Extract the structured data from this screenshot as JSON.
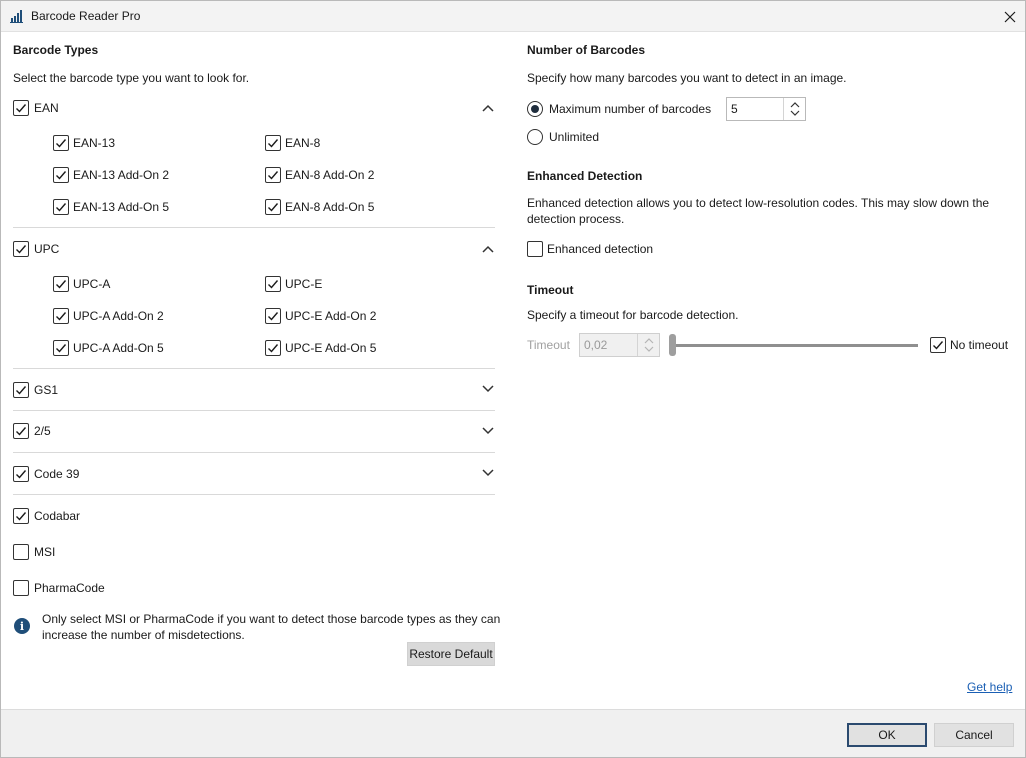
{
  "window": {
    "title": "Barcode Reader Pro"
  },
  "barcode_types": {
    "heading": "Barcode Types",
    "description": "Select the barcode type you want to look for.",
    "ean": {
      "label": "EAN",
      "checked": true,
      "expanded": true,
      "items": [
        {
          "label": "EAN-13",
          "checked": true
        },
        {
          "label": "EAN-8",
          "checked": true
        },
        {
          "label": "EAN-13 Add-On 2",
          "checked": true
        },
        {
          "label": "EAN-8 Add-On 2",
          "checked": true
        },
        {
          "label": "EAN-13 Add-On 5",
          "checked": true
        },
        {
          "label": "EAN-8 Add-On 5",
          "checked": true
        }
      ]
    },
    "upc": {
      "label": "UPC",
      "checked": true,
      "expanded": true,
      "items": [
        {
          "label": "UPC-A",
          "checked": true
        },
        {
          "label": "UPC-E",
          "checked": true
        },
        {
          "label": "UPC-A Add-On 2",
          "checked": true
        },
        {
          "label": "UPC-E Add-On 2",
          "checked": true
        },
        {
          "label": "UPC-A Add-On 5",
          "checked": true
        },
        {
          "label": "UPC-E Add-On 5",
          "checked": true
        }
      ]
    },
    "gs1": {
      "label": "GS1",
      "checked": true,
      "expanded": false
    },
    "two_five": {
      "label": "2/5",
      "checked": true,
      "expanded": false
    },
    "code39": {
      "label": "Code 39",
      "checked": true,
      "expanded": false
    },
    "codabar": {
      "label": "Codabar",
      "checked": true
    },
    "msi": {
      "label": "MSI",
      "checked": false
    },
    "pharmacode": {
      "label": "PharmaCode",
      "checked": false
    },
    "info_note": "Only select MSI or PharmaCode if you want to detect those barcode types as they can increase the number of misdetections.",
    "restore_default": "Restore Default"
  },
  "number_of_barcodes": {
    "heading": "Number of Barcodes",
    "description": "Specify how many barcodes you want to detect in an image.",
    "max_label": "Maximum number of barcodes",
    "max_value": "5",
    "max_selected": true,
    "unlimited_label": "Unlimited",
    "unlimited_selected": false
  },
  "enhanced_detection": {
    "heading": "Enhanced Detection",
    "description": "Enhanced detection allows you to detect low-resolution codes. This may slow down the detection process.",
    "checkbox_label": "Enhanced detection",
    "checked": false
  },
  "timeout": {
    "heading": "Timeout",
    "description": "Specify a timeout for barcode detection.",
    "field_label": "Timeout",
    "value": "0,02",
    "slider_fraction": 0,
    "no_timeout_label": "No timeout",
    "no_timeout_checked": true
  },
  "footer": {
    "get_help": "Get help",
    "ok": "OK",
    "cancel": "Cancel"
  }
}
